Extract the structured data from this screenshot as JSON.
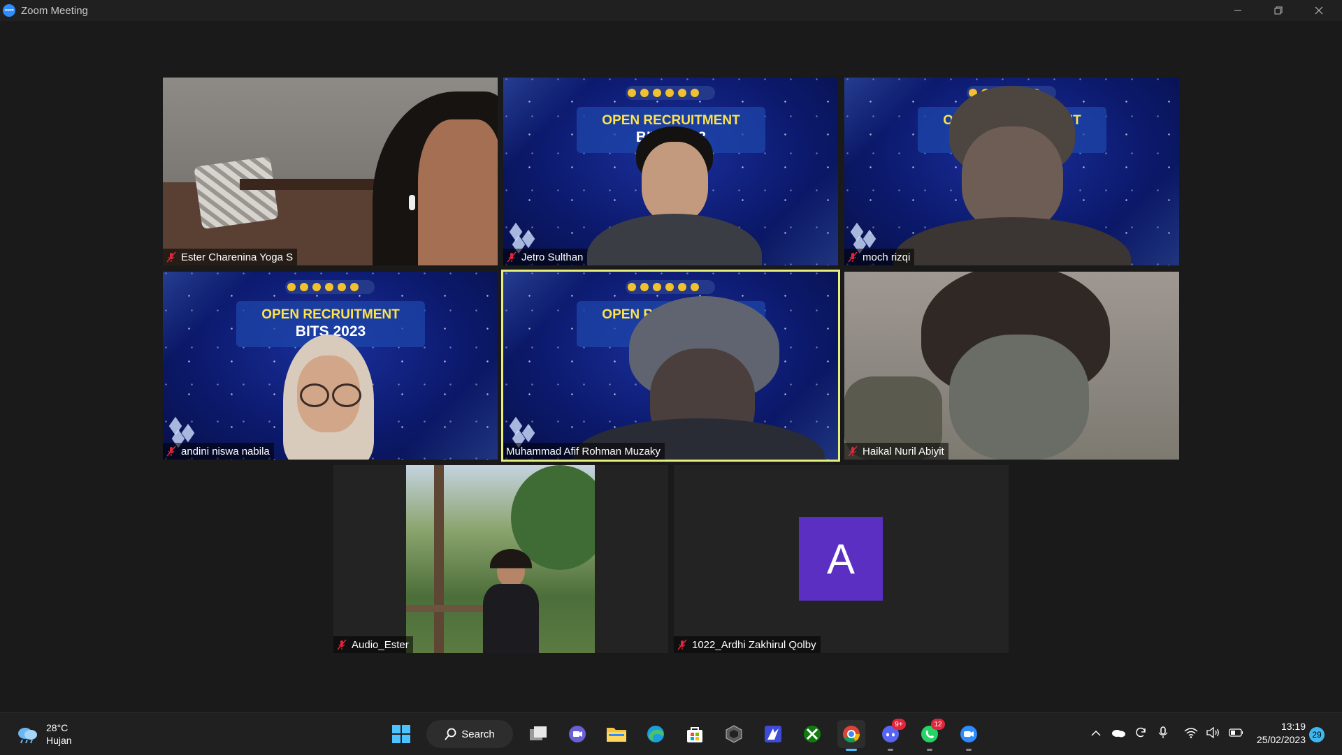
{
  "window": {
    "title": "Zoom Meeting",
    "app_icon_text": "zoom",
    "controls": [
      "minimize",
      "restore",
      "close"
    ]
  },
  "background_banner": {
    "line1": "OPEN RECRUITMENT",
    "line2": "BITS 2023"
  },
  "participants": [
    {
      "name": "Ester Charenina Yoga S",
      "muted": true,
      "video": "camera"
    },
    {
      "name": "Jetro Sulthan",
      "muted": true,
      "video": "virtual-background"
    },
    {
      "name": "moch rizqi",
      "muted": true,
      "video": "virtual-background"
    },
    {
      "name": "andini niswa nabila",
      "muted": true,
      "video": "virtual-background"
    },
    {
      "name": "Muhammad Afif Rohman Muzaky",
      "muted": false,
      "video": "virtual-background",
      "active_speaker": true
    },
    {
      "name": "Haikal Nuril Abiyit",
      "muted": true,
      "video": "camera"
    },
    {
      "name": "Audio_Ester",
      "muted": true,
      "video": "photo"
    },
    {
      "name": "1022_Ardhi Zakhirul Qolby",
      "muted": true,
      "video": "avatar",
      "avatar_letter": "A"
    }
  ],
  "taskbar": {
    "weather": {
      "temp": "28°C",
      "condition": "Hujan"
    },
    "search_label": "Search",
    "apps": [
      {
        "name": "start-icon"
      },
      {
        "name": "task-view-icon"
      },
      {
        "name": "meet-icon"
      },
      {
        "name": "file-explorer-icon"
      },
      {
        "name": "edge-icon"
      },
      {
        "name": "store-icon"
      },
      {
        "name": "unity-icon"
      },
      {
        "name": "studio-icon"
      },
      {
        "name": "xbox-icon"
      },
      {
        "name": "chrome-icon",
        "active": true
      },
      {
        "name": "discord-icon",
        "badge": "9+"
      },
      {
        "name": "whatsapp-icon",
        "badge": "12"
      },
      {
        "name": "zoom-icon"
      }
    ],
    "clock": {
      "time": "13:19",
      "date": "25/02/2023"
    },
    "notification_count": "29"
  },
  "colors": {
    "active_speaker_border": "#e6ef7c",
    "avatar_bg": "#5b2fc2",
    "mic_muted": "#e0263b",
    "banner_text": "#ffe34a"
  }
}
